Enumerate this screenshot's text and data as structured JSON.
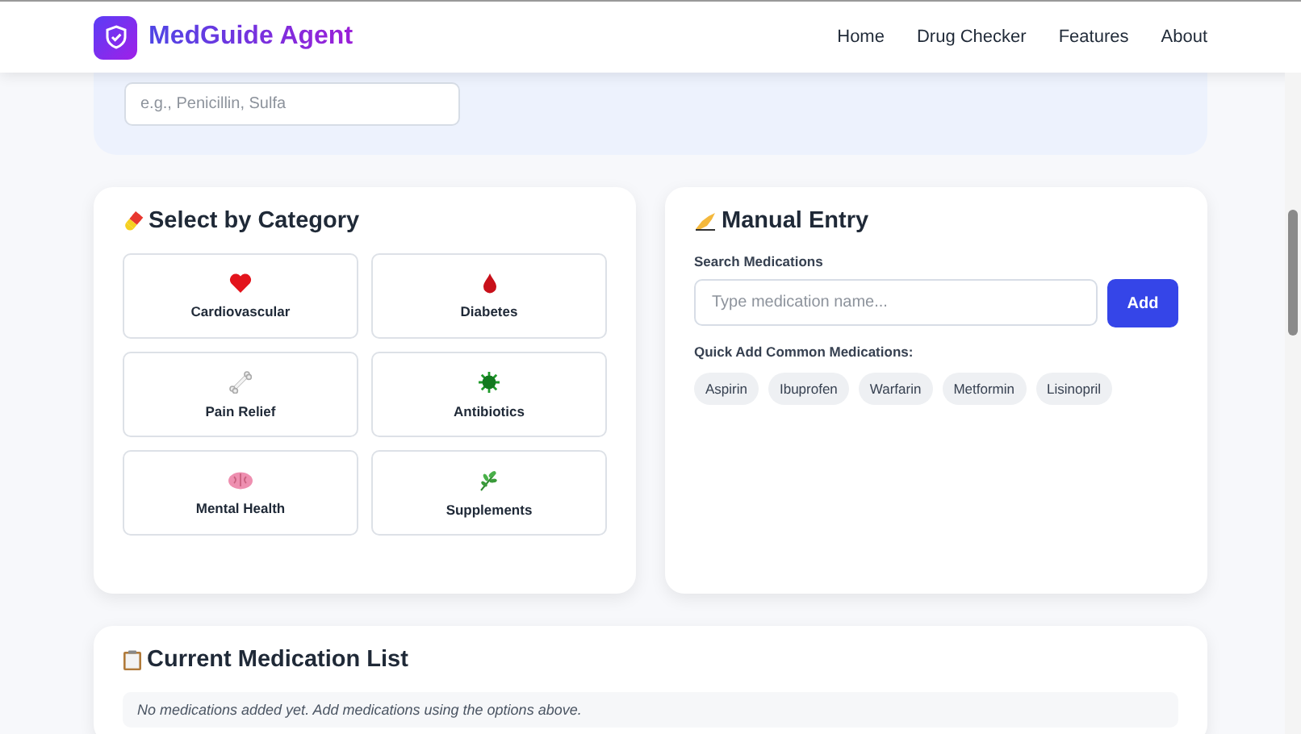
{
  "header": {
    "brand": "MedGuide Agent",
    "nav": [
      {
        "label": "Home"
      },
      {
        "label": "Drug Checker"
      },
      {
        "label": "Features"
      },
      {
        "label": "About"
      }
    ]
  },
  "allergies": {
    "placeholder": "e.g., Penicillin, Sulfa"
  },
  "categories": {
    "title": "Select by Category",
    "items": [
      {
        "label": "Cardiovascular",
        "kind": "heart"
      },
      {
        "label": "Diabetes",
        "kind": "drop"
      },
      {
        "label": "Pain Relief",
        "kind": "bone"
      },
      {
        "label": "Antibiotics",
        "kind": "germ"
      },
      {
        "label": "Mental Health",
        "kind": "brain"
      },
      {
        "label": "Supplements",
        "kind": "leaf"
      }
    ]
  },
  "manual_entry": {
    "title": "Manual Entry",
    "search_label": "Search Medications",
    "placeholder": "Type medication name...",
    "add_button": "Add",
    "quick_label": "Quick Add Common Medications:",
    "quick": [
      "Aspirin",
      "Ibuprofen",
      "Warfarin",
      "Metformin",
      "Lisinopril"
    ]
  },
  "medication_list": {
    "title": "Current Medication List",
    "empty_text": "No medications added yet. Add medications using the options above."
  }
}
